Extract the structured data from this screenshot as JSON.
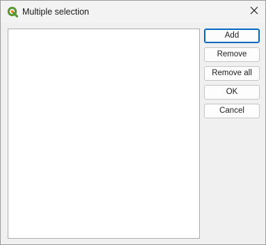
{
  "window": {
    "title": "Multiple selection",
    "close_glyph": "✕",
    "app_icon": "qgis-logo-icon",
    "close_icon": "close-icon"
  },
  "list": {
    "items": []
  },
  "buttons": {
    "add": "Add",
    "remove": "Remove",
    "remove_all": "Remove all",
    "ok": "OK",
    "cancel": "Cancel"
  },
  "colors": {
    "accent": "#0067c0",
    "qgis_green": "#589632",
    "qgis_yellow": "#ee7913"
  }
}
